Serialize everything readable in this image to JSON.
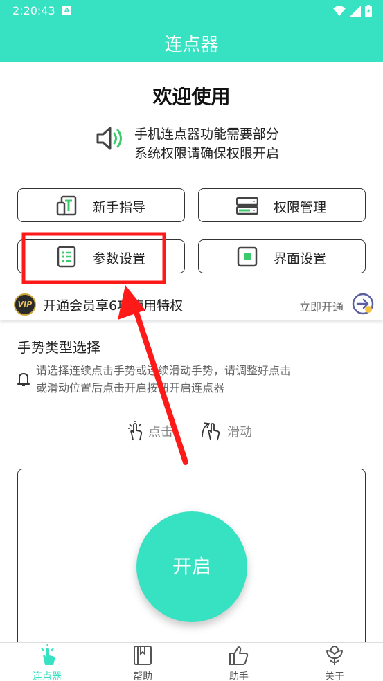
{
  "status": {
    "time": "2:20:43",
    "indicator": "A"
  },
  "header": {
    "title": "连点器"
  },
  "welcome": "欢迎使用",
  "notice": {
    "line1": "手机连点器功能需要部分",
    "line2": "系统权限请确保权限开启"
  },
  "buttons": {
    "guide": "新手指导",
    "permission": "权限管理",
    "params": "参数设置",
    "ui_settings": "界面设置"
  },
  "vip": {
    "badge": "VIP",
    "text": "开通会员享6项使用特权",
    "cta": "立即开通"
  },
  "gesture_section": {
    "title": "手势类型选择",
    "tip": "请选择连续点击手势或连续滑动手势，请调整好点击或滑动位置后点击开启按钮开启连点器",
    "options": [
      "点击",
      "滑动"
    ]
  },
  "start_button": "开启",
  "tabs": [
    {
      "label": "连点器",
      "icon": "tap-icon",
      "active": true
    },
    {
      "label": "帮助",
      "icon": "book-icon",
      "active": false
    },
    {
      "label": "助手",
      "icon": "thumbs-up-icon",
      "active": false
    },
    {
      "label": "关于",
      "icon": "flower-icon",
      "active": false
    }
  ],
  "colors": {
    "accent": "#37e2c2",
    "highlight": "#ff0000",
    "vip_gold": "#c9a43d"
  }
}
